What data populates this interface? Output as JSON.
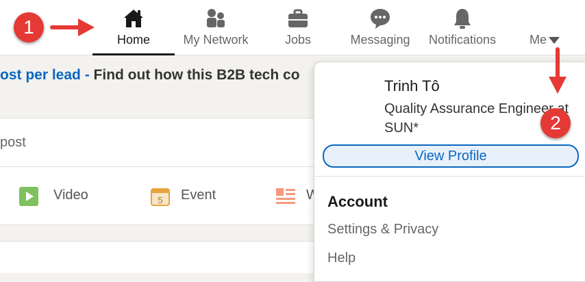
{
  "nav": {
    "items": [
      {
        "label": "Home",
        "icon": "home-icon",
        "active": true
      },
      {
        "label": "My Network",
        "icon": "network-icon",
        "active": false
      },
      {
        "label": "Jobs",
        "icon": "briefcase-icon",
        "active": false
      },
      {
        "label": "Messaging",
        "icon": "chat-icon",
        "active": false
      },
      {
        "label": "Notifications",
        "icon": "bell-icon",
        "active": false
      },
      {
        "label": "Me",
        "icon": "chevron-down-icon",
        "active": false
      }
    ]
  },
  "feed": {
    "banner_link": "ost per lead - ",
    "banner_text": "Find out how this B2B tech co",
    "start_post_text": "post",
    "actions": [
      {
        "label": "Video",
        "icon": "video-icon",
        "color": "#7fc15e"
      },
      {
        "label": "Event",
        "icon": "calendar-icon",
        "color": "#e7a33e",
        "day": "5"
      },
      {
        "label": "W",
        "icon": "article-icon",
        "color": "#f5987e"
      }
    ]
  },
  "me_menu": {
    "name": "Trinh Tô",
    "headline": "Quality Assurance Engineer at SUN*",
    "view_profile_label": "View Profile",
    "account_heading": "Account",
    "settings_label": "Settings & Privacy",
    "help_label": "Help"
  },
  "annotations": {
    "badge1": "1",
    "badge2": "2",
    "color": "#e53935"
  }
}
